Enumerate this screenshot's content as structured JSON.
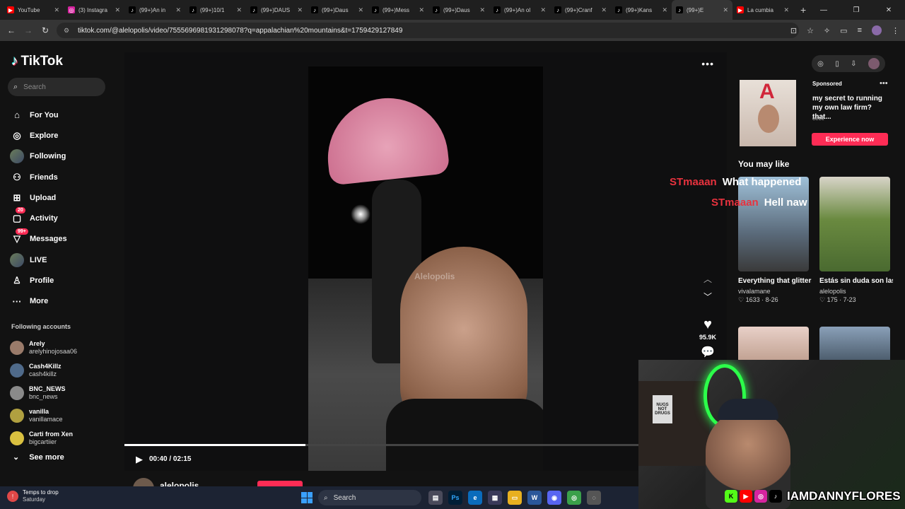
{
  "browser": {
    "tabs": [
      {
        "title": "YouTube",
        "color": "#ff0000"
      },
      {
        "title": "(3) Instagra",
        "color": "#d6249f"
      },
      {
        "title": "(99+)An in",
        "color": "#000000"
      },
      {
        "title": "(99+)10/1",
        "color": "#000000"
      },
      {
        "title": "(99+)DAUS",
        "color": "#000000"
      },
      {
        "title": "(99+)Daus",
        "color": "#000000"
      },
      {
        "title": "(99+)Mess",
        "color": "#000000"
      },
      {
        "title": "(99+)Daus",
        "color": "#000000"
      },
      {
        "title": "(99+)An ol",
        "color": "#000000"
      },
      {
        "title": "(99+)Cranf",
        "color": "#000000"
      },
      {
        "title": "(99+)Kans",
        "color": "#000000"
      },
      {
        "title": "(99+)E",
        "color": "#000000"
      },
      {
        "title": "La cumbia",
        "color": "#ff0000"
      }
    ],
    "url": "tiktok.com/@alelopolis/video/7555696981931298078?q=appalachian%20mountains&t=1759429127849"
  },
  "sidebar": {
    "logo": "TikTok",
    "search_placeholder": "Search",
    "nav": [
      {
        "label": "For You",
        "icon": "home-icon"
      },
      {
        "label": "Explore",
        "icon": "compass-icon"
      },
      {
        "label": "Following",
        "icon": "avatar-icon"
      },
      {
        "label": "Friends",
        "icon": "friends-icon"
      },
      {
        "label": "Upload",
        "icon": "upload-icon"
      },
      {
        "label": "Activity",
        "icon": "activity-icon",
        "badge": "20"
      },
      {
        "label": "Messages",
        "icon": "messages-icon",
        "badge": "99+"
      },
      {
        "label": "LIVE",
        "icon": "live-icon"
      },
      {
        "label": "Profile",
        "icon": "profile-icon"
      },
      {
        "label": "More",
        "icon": "more-icon"
      }
    ],
    "following_heading": "Following accounts",
    "following": [
      {
        "name": "Arely",
        "handle": "arelyhinojosaa06",
        "color": "#9a7b6a"
      },
      {
        "name": "Cash4Killz",
        "handle": "cash4killz",
        "color": "#4f6a8a"
      },
      {
        "name": "BNC_NEWS",
        "handle": "bnc_news",
        "color": "#8a8a8a"
      },
      {
        "name": "vanilla",
        "handle": "vanillamace",
        "color": "#b0a040"
      },
      {
        "name": "Carti from Xen",
        "handle": "bigcartiier",
        "color": "#d9c040"
      }
    ],
    "see_more": "See more"
  },
  "video": {
    "watermark": "Alelopolis",
    "progress": 0.3,
    "time": "00:40 / 02:15",
    "author": "alelopolis",
    "likes": "95.9K"
  },
  "right_panel": {
    "sponsored": "Sponsored",
    "ad_text": "my secret to running my own law firm? that...",
    "ad_brand": "cece",
    "ad_cta": "Experience now",
    "you_may_like": "You may like",
    "cards": [
      {
        "title": "Everything that glitters in Hollywoo...",
        "author": "vivalamane",
        "stats": "♡ 1633 · 8-26"
      },
      {
        "title": "Estás sin duda son las botas que...",
        "author": "alelopolis",
        "stats": "♡ 175 · 7-23"
      }
    ]
  },
  "chat": [
    {
      "user": "STmaaan",
      "message": "What happened"
    },
    {
      "user": "STmaaan",
      "message": "Hell naw"
    }
  ],
  "webcam": {
    "handle": "IAMDANNYFLORES",
    "sign_text": "NUGS NOT DRUGS"
  },
  "taskbar": {
    "weather_line1": "Temps to drop",
    "weather_line2": "Saturday",
    "search": "Search"
  }
}
